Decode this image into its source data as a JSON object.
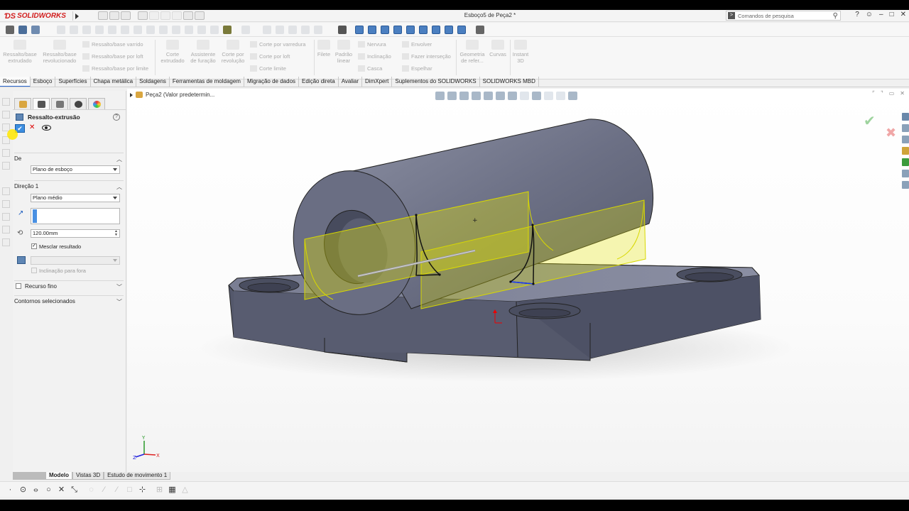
{
  "app": {
    "brand": "SOLIDWORKS",
    "document_title": "Esboço5 de Peça2 *",
    "search_placeholder": "Comandos de pesquisa",
    "help_glyph": "?",
    "win_min": "–",
    "win_max": "□",
    "win_close": "✕"
  },
  "ribbon": {
    "extrude_boss": "Ressalto/base extrudado",
    "revolve_boss": "Ressalto/base revolucionado",
    "swept_boss": "Ressalto/base varrido",
    "loft_boss": "Ressalto/base por loft",
    "boundary_boss": "Ressalto/base por limite",
    "extruded_cut": "Corte extrudado",
    "hole_wizard": "Assistente de furação",
    "revolved_cut": "Corte por revolução",
    "swept_cut": "Corte por varredura",
    "lofted_cut": "Corte por loft",
    "boundary_cut": "Corte limite",
    "fillet": "Filete",
    "linear_pattern": "Padrão linear",
    "rib": "Nervura",
    "draft": "Inclinação",
    "shell": "Casca",
    "wrap": "Envolver",
    "intersect": "Fazer interseção",
    "mirror": "Espelhar",
    "ref_geometry": "Geometria de refer...",
    "curves": "Curvas",
    "instant3d": "Instant 3D"
  },
  "tabs": [
    "Recursos",
    "Esboço",
    "Superfícies",
    "Chapa metálica",
    "Soldagens",
    "Ferramentas de moldagem",
    "Migração de dados",
    "Edição direta",
    "Avaliar",
    "DimXpert",
    "Suplementos do SOLIDWORKS",
    "SOLIDWORKS MBD"
  ],
  "property_manager": {
    "title": "Ressalto-extrusão",
    "ok_glyph": "✔",
    "cancel_glyph": "✕",
    "from_header": "De",
    "from_value": "Plano de esboço",
    "direction1_header": "Direção 1",
    "end_condition": "Plano médio",
    "depth": "120.00mm",
    "merge_result_label": "Mesclar resultado",
    "merge_result_checked": true,
    "draft_outward_label": "Inclinação para fora",
    "thin_feature_label": "Recurso fino",
    "selected_contours_label": "Contornos selecionados"
  },
  "viewport": {
    "tree_label": "Peça2  (Valor predetermin...",
    "ok_glyph": "✔",
    "cancel_glyph": "✖"
  },
  "bottom_tabs": [
    "Modelo",
    "Vistas 3D",
    "Estudo de movimento 1"
  ],
  "colors": {
    "accent": "#2c6ad3",
    "brand_red": "#d21e1e",
    "part_fill": "#5b5f73",
    "preview_yellow": "#e6e600"
  }
}
